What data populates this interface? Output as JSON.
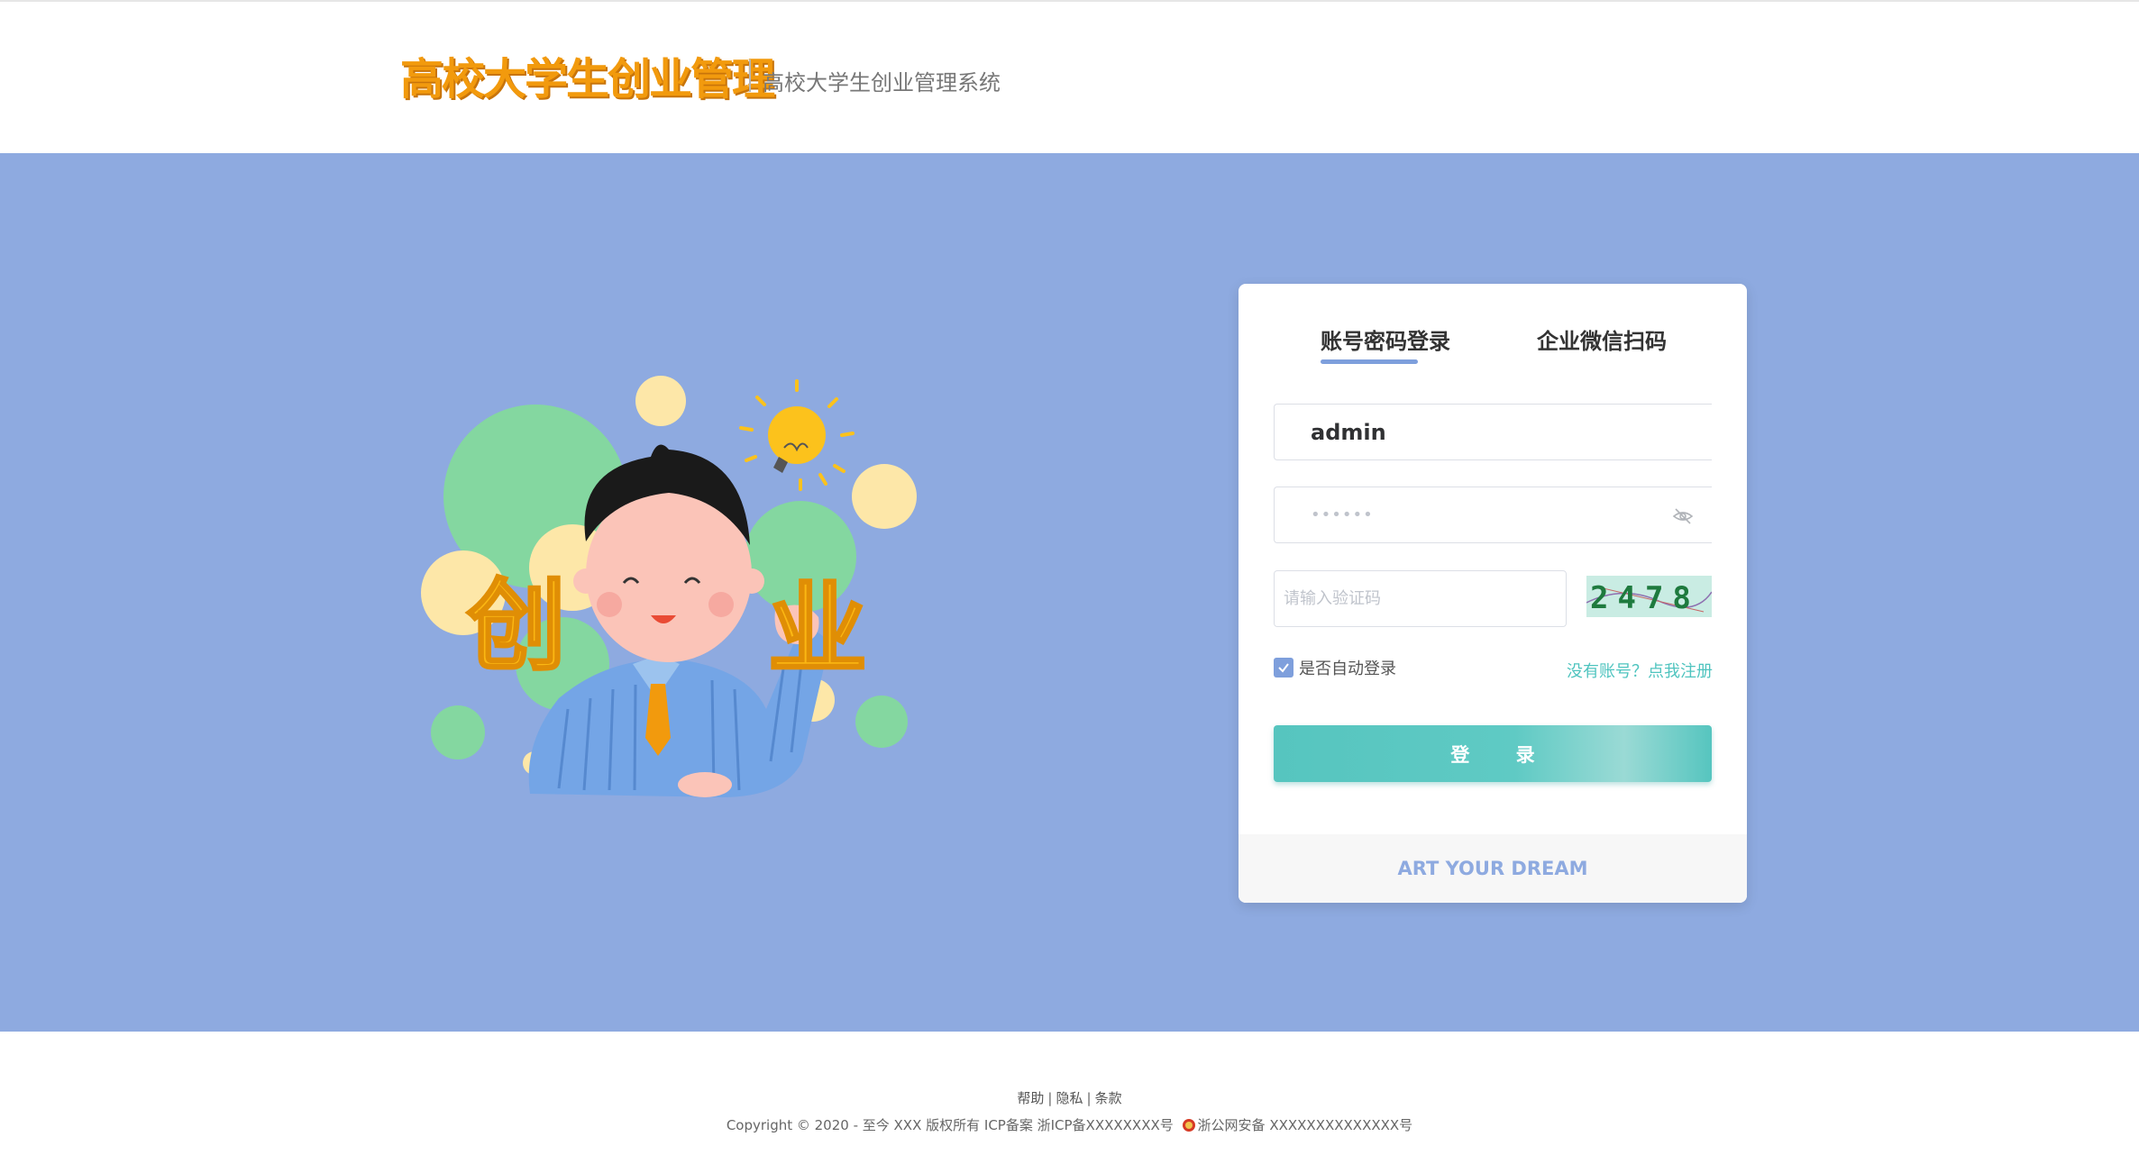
{
  "header": {
    "logo_text": "高校大学生创业管理",
    "subtitle": "高校大学生创业管理系统"
  },
  "illustration": {
    "characters": "创 业",
    "char_1": "创",
    "char_2": "业"
  },
  "login": {
    "tabs": [
      {
        "label": "账号密码登录",
        "active": true
      },
      {
        "label": "企业微信扫码",
        "active": false
      }
    ],
    "username": {
      "value": "admin"
    },
    "password": {
      "value": "••••••"
    },
    "captcha": {
      "placeholder": "请输入验证码",
      "image_text": "2478"
    },
    "remember": {
      "label": "是否自动登录",
      "checked": true
    },
    "register_link": "没有账号？点我注册",
    "submit_label": "登 录",
    "footer_slogan": "ART YOUR DREAM"
  },
  "footer": {
    "links": [
      "帮助",
      "隐私",
      "条款"
    ],
    "copyright": "Copyright © 2020 - 至今 XXX 版权所有 ICP备案 浙ICP备XXXXXXXX号",
    "police_record": "浙公网安备 XXXXXXXXXXXXXX号"
  },
  "colors": {
    "banner_bg": "#8eaae0",
    "brand_orange": "#f29a0d",
    "accent_teal": "#56c5bf",
    "tab_accent": "#7e9fdc"
  }
}
